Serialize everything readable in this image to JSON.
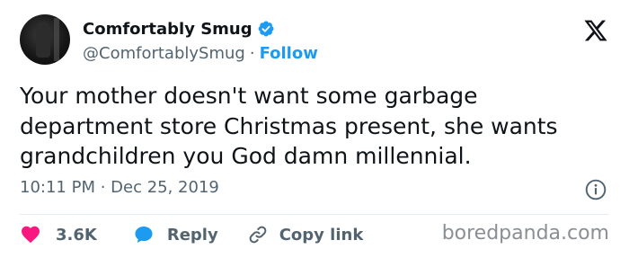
{
  "author": {
    "name": "Comfortably Smug",
    "handle": "@ComfortablySmug",
    "separator": "·",
    "follow_label": "Follow",
    "verified_icon": "verified-badge-icon"
  },
  "platform_logo": "x-logo-icon",
  "tweet": {
    "text": "Your mother doesn't want some garbage\ndepartment store Christmas present, she wants\ngrandchildren you God damn millennial.",
    "timestamp": "10:11 PM · Dec 25, 2019"
  },
  "actions": {
    "like_count": "3.6K",
    "reply_label": "Reply",
    "copy_link_label": "Copy link"
  },
  "watermark": "boredpanda.com",
  "colors": {
    "accent": "#1d9bf0",
    "like": "#f91880",
    "text": "#0f1419",
    "muted": "#536471"
  }
}
